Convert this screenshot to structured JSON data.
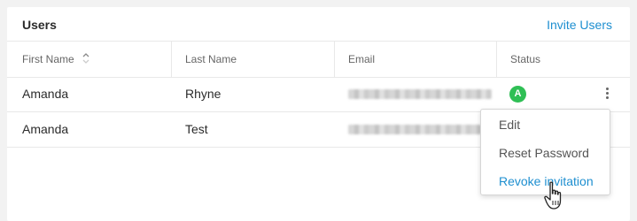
{
  "card": {
    "title": "Users",
    "invite_label": "Invite Users"
  },
  "table": {
    "columns": [
      "First Name",
      "Last Name",
      "Email",
      "Status"
    ],
    "rows": [
      {
        "first": "Amanda",
        "last": "Rhyne",
        "status_badge": "A"
      },
      {
        "first": "Amanda",
        "last": "Test"
      }
    ]
  },
  "menu": {
    "items": [
      "Edit",
      "Reset Password",
      "Revoke invitation"
    ]
  },
  "colors": {
    "accent": "#1e8fd0",
    "status_green": "#2fbf55"
  },
  "icons": {
    "sort": "sort-icon",
    "kebab": "kebab-icon",
    "cursor": "hand-cursor-icon"
  }
}
